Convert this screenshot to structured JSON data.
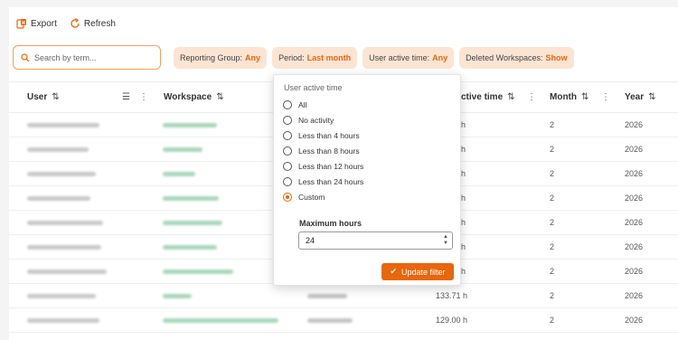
{
  "toolbar": {
    "export_label": "Export",
    "refresh_label": "Refresh"
  },
  "filters": {
    "search_placeholder": "Search by term...",
    "chips": [
      {
        "label": "Reporting Group:",
        "value": "Any"
      },
      {
        "label": "Period:",
        "value": "Last month"
      },
      {
        "label": "User active time:",
        "value": "Any"
      },
      {
        "label": "Deleted Workspaces:",
        "value": "Show"
      }
    ]
  },
  "table": {
    "columns": {
      "user": "User",
      "workspace": "Workspace",
      "active_time": "ctive time",
      "month": "Month",
      "year": "Year"
    },
    "rows": [
      {
        "active": "h",
        "month": "2",
        "year": "2026"
      },
      {
        "active": "h",
        "month": "2",
        "year": "2026"
      },
      {
        "active": "h",
        "month": "2",
        "year": "2026"
      },
      {
        "active": "h",
        "month": "2",
        "year": "2026"
      },
      {
        "active": "h",
        "month": "2",
        "year": "2026"
      },
      {
        "active": "h",
        "month": "2",
        "year": "2026"
      },
      {
        "active": "h",
        "month": "2",
        "year": "2026"
      },
      {
        "active": "133.71 h",
        "month": "2",
        "year": "2026"
      },
      {
        "active": "129.00 h",
        "month": "2",
        "year": "2026"
      }
    ]
  },
  "dropdown": {
    "title": "User active time",
    "options": [
      "All",
      "No activity",
      "Less than 4 hours",
      "Less than 8 hours",
      "Less than 12 hours",
      "Less than 24 hours",
      "Custom"
    ],
    "selected": "Custom",
    "max_hours_label": "Maximum hours",
    "max_hours_value": "24",
    "update_label": "Update filter"
  },
  "colors": {
    "accent": "#e8660c",
    "chip_bg": "#fce4d3"
  }
}
